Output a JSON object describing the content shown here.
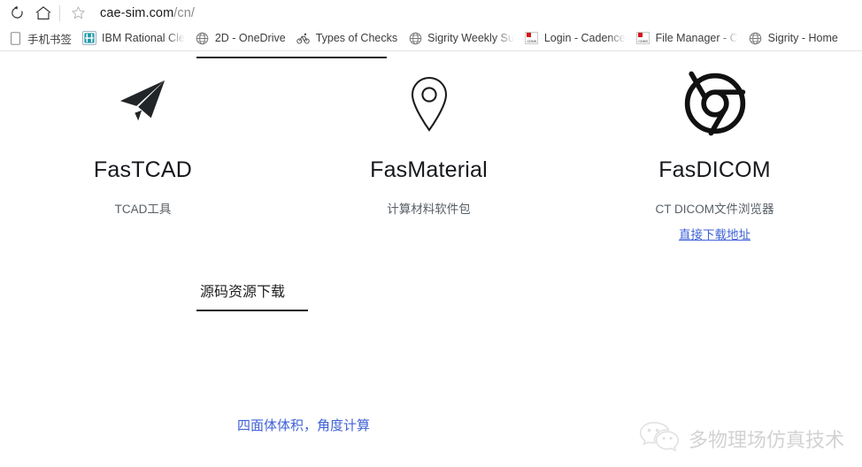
{
  "browser": {
    "toolbar": {
      "reload_icon": "reload-icon",
      "home_icon": "home-icon",
      "bookmark_star_icon": "star-icon",
      "url_domain": "cae-sim.com",
      "url_path": "/cn/"
    },
    "bookmarks": [
      {
        "label": "手机书签",
        "icon": "phone-icon",
        "truncated": false
      },
      {
        "label": "IBM Rational Cle",
        "icon": "ibm-rational-icon",
        "truncated": true
      },
      {
        "label": "2D - OneDrive",
        "icon": "globe-icon",
        "truncated": false
      },
      {
        "label": "Types of Checks",
        "icon": "bike-icon",
        "truncated": false
      },
      {
        "label": "Sigrity Weekly Su",
        "icon": "globe-icon",
        "truncated": true
      },
      {
        "label": "Login - Cadence",
        "icon": "cdns-icon",
        "truncated": true
      },
      {
        "label": "File Manager - C",
        "icon": "cdns-icon",
        "truncated": true
      },
      {
        "label": "Sigrity - Home",
        "icon": "globe-icon",
        "truncated": false
      }
    ]
  },
  "page": {
    "cards": [
      {
        "icon": "paper-plane-icon",
        "title": "FasTCAD",
        "subtitle": "TCAD工具",
        "link": ""
      },
      {
        "icon": "map-pin-icon",
        "title": "FasMaterial",
        "subtitle": "计算材料软件包",
        "link": ""
      },
      {
        "icon": "chrome-icon",
        "title": "FasDICOM",
        "subtitle": "CT DICOM文件浏览器",
        "link": "直接下载地址"
      }
    ],
    "section": {
      "title": "源码资源下载"
    },
    "links": [
      {
        "label": "四面体体积，角度计算"
      }
    ],
    "watermark": {
      "icon": "wechat-icon",
      "text": "多物理场仿真技术"
    }
  }
}
